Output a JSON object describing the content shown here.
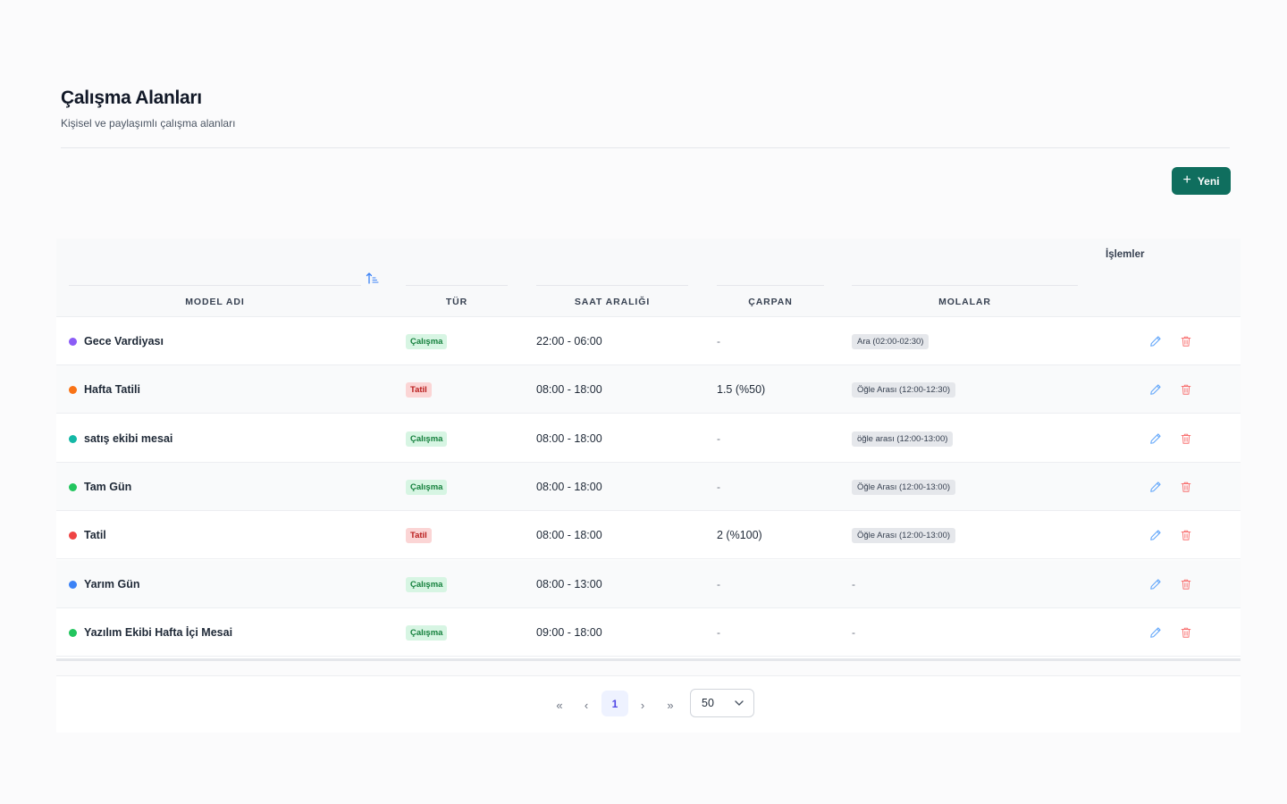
{
  "page": {
    "title": "Çalışma Alanları",
    "subtitle": "Kişisel ve paylaşımlı çalışma alanları"
  },
  "toolbar": {
    "new_label": "Yeni"
  },
  "table": {
    "columns": {
      "model_name": "MODEL ADI",
      "type": "TÜR",
      "time_range": "SAAT ARALIĞI",
      "multiplier": "ÇARPAN",
      "breaks": "MOLALAR",
      "actions": "İşlemler"
    },
    "rows": [
      {
        "name": "Gece Vardiyası",
        "color": "#8b5cf6",
        "type": "Çalışma",
        "type_kind": "work",
        "time": "22:00 - 06:00",
        "multiplier": "-",
        "breaks": "Ara (02:00-02:30)"
      },
      {
        "name": "Hafta Tatili",
        "color": "#f97316",
        "type": "Tatil",
        "type_kind": "holiday",
        "time": "08:00 - 18:00",
        "multiplier": "1.5 (%50)",
        "breaks": "Öğle Arası (12:00-12:30)"
      },
      {
        "name": "satış ekibi mesai",
        "color": "#14b8a6",
        "type": "Çalışma",
        "type_kind": "work",
        "time": "08:00 - 18:00",
        "multiplier": "-",
        "breaks": "öğle arası (12:00-13:00)"
      },
      {
        "name": "Tam Gün",
        "color": "#22c55e",
        "type": "Çalışma",
        "type_kind": "work",
        "time": "08:00 - 18:00",
        "multiplier": "-",
        "breaks": "Öğle Arası (12:00-13:00)"
      },
      {
        "name": "Tatil",
        "color": "#ef4444",
        "type": "Tatil",
        "type_kind": "holiday",
        "time": "08:00 - 18:00",
        "multiplier": "2 (%100)",
        "breaks": "Öğle Arası (12:00-13:00)"
      },
      {
        "name": "Yarım Gün",
        "color": "#3b82f6",
        "type": "Çalışma",
        "type_kind": "work",
        "time": "08:00 - 13:00",
        "multiplier": "-",
        "breaks": "-"
      },
      {
        "name": "Yazılım Ekibi Hafta İçi Mesai",
        "color": "#22c55e",
        "type": "Çalışma",
        "type_kind": "work",
        "time": "09:00 - 18:00",
        "multiplier": "-",
        "breaks": "-"
      }
    ]
  },
  "pagination": {
    "first_icon": "«",
    "prev_icon": "‹",
    "current_page": "1",
    "next_icon": "›",
    "last_icon": "»",
    "page_size": "50"
  },
  "icons": {
    "sort": "sort-ascending-icon",
    "plus": "plus-icon",
    "edit": "pencil-icon",
    "delete": "trash-icon",
    "dropdown": "chevron-down-icon"
  },
  "colors": {
    "primary": "#0f6e5e",
    "edit_icon": "#60a5fa",
    "delete_icon": "#f87171",
    "active_page": "#4f46e5"
  }
}
